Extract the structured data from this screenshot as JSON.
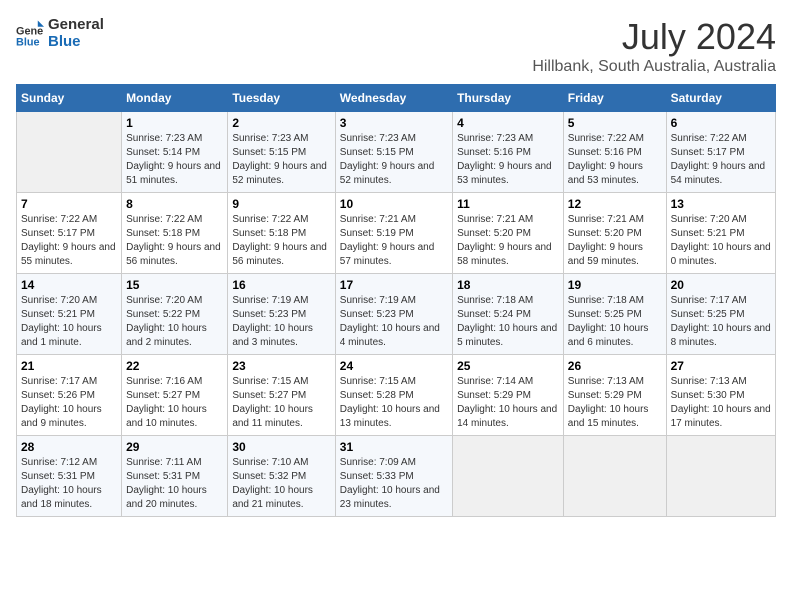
{
  "logo": {
    "text_general": "General",
    "text_blue": "Blue"
  },
  "title": "July 2024",
  "subtitle": "Hillbank, South Australia, Australia",
  "days_of_week": [
    "Sunday",
    "Monday",
    "Tuesday",
    "Wednesday",
    "Thursday",
    "Friday",
    "Saturday"
  ],
  "weeks": [
    [
      {
        "day": "",
        "sunrise": "",
        "sunset": "",
        "daylight": ""
      },
      {
        "day": "1",
        "sunrise": "Sunrise: 7:23 AM",
        "sunset": "Sunset: 5:14 PM",
        "daylight": "Daylight: 9 hours and 51 minutes."
      },
      {
        "day": "2",
        "sunrise": "Sunrise: 7:23 AM",
        "sunset": "Sunset: 5:15 PM",
        "daylight": "Daylight: 9 hours and 52 minutes."
      },
      {
        "day": "3",
        "sunrise": "Sunrise: 7:23 AM",
        "sunset": "Sunset: 5:15 PM",
        "daylight": "Daylight: 9 hours and 52 minutes."
      },
      {
        "day": "4",
        "sunrise": "Sunrise: 7:23 AM",
        "sunset": "Sunset: 5:16 PM",
        "daylight": "Daylight: 9 hours and 53 minutes."
      },
      {
        "day": "5",
        "sunrise": "Sunrise: 7:22 AM",
        "sunset": "Sunset: 5:16 PM",
        "daylight": "Daylight: 9 hours and 53 minutes."
      },
      {
        "day": "6",
        "sunrise": "Sunrise: 7:22 AM",
        "sunset": "Sunset: 5:17 PM",
        "daylight": "Daylight: 9 hours and 54 minutes."
      }
    ],
    [
      {
        "day": "7",
        "sunrise": "Sunrise: 7:22 AM",
        "sunset": "Sunset: 5:17 PM",
        "daylight": "Daylight: 9 hours and 55 minutes."
      },
      {
        "day": "8",
        "sunrise": "Sunrise: 7:22 AM",
        "sunset": "Sunset: 5:18 PM",
        "daylight": "Daylight: 9 hours and 56 minutes."
      },
      {
        "day": "9",
        "sunrise": "Sunrise: 7:22 AM",
        "sunset": "Sunset: 5:18 PM",
        "daylight": "Daylight: 9 hours and 56 minutes."
      },
      {
        "day": "10",
        "sunrise": "Sunrise: 7:21 AM",
        "sunset": "Sunset: 5:19 PM",
        "daylight": "Daylight: 9 hours and 57 minutes."
      },
      {
        "day": "11",
        "sunrise": "Sunrise: 7:21 AM",
        "sunset": "Sunset: 5:20 PM",
        "daylight": "Daylight: 9 hours and 58 minutes."
      },
      {
        "day": "12",
        "sunrise": "Sunrise: 7:21 AM",
        "sunset": "Sunset: 5:20 PM",
        "daylight": "Daylight: 9 hours and 59 minutes."
      },
      {
        "day": "13",
        "sunrise": "Sunrise: 7:20 AM",
        "sunset": "Sunset: 5:21 PM",
        "daylight": "Daylight: 10 hours and 0 minutes."
      }
    ],
    [
      {
        "day": "14",
        "sunrise": "Sunrise: 7:20 AM",
        "sunset": "Sunset: 5:21 PM",
        "daylight": "Daylight: 10 hours and 1 minute."
      },
      {
        "day": "15",
        "sunrise": "Sunrise: 7:20 AM",
        "sunset": "Sunset: 5:22 PM",
        "daylight": "Daylight: 10 hours and 2 minutes."
      },
      {
        "day": "16",
        "sunrise": "Sunrise: 7:19 AM",
        "sunset": "Sunset: 5:23 PM",
        "daylight": "Daylight: 10 hours and 3 minutes."
      },
      {
        "day": "17",
        "sunrise": "Sunrise: 7:19 AM",
        "sunset": "Sunset: 5:23 PM",
        "daylight": "Daylight: 10 hours and 4 minutes."
      },
      {
        "day": "18",
        "sunrise": "Sunrise: 7:18 AM",
        "sunset": "Sunset: 5:24 PM",
        "daylight": "Daylight: 10 hours and 5 minutes."
      },
      {
        "day": "19",
        "sunrise": "Sunrise: 7:18 AM",
        "sunset": "Sunset: 5:25 PM",
        "daylight": "Daylight: 10 hours and 6 minutes."
      },
      {
        "day": "20",
        "sunrise": "Sunrise: 7:17 AM",
        "sunset": "Sunset: 5:25 PM",
        "daylight": "Daylight: 10 hours and 8 minutes."
      }
    ],
    [
      {
        "day": "21",
        "sunrise": "Sunrise: 7:17 AM",
        "sunset": "Sunset: 5:26 PM",
        "daylight": "Daylight: 10 hours and 9 minutes."
      },
      {
        "day": "22",
        "sunrise": "Sunrise: 7:16 AM",
        "sunset": "Sunset: 5:27 PM",
        "daylight": "Daylight: 10 hours and 10 minutes."
      },
      {
        "day": "23",
        "sunrise": "Sunrise: 7:15 AM",
        "sunset": "Sunset: 5:27 PM",
        "daylight": "Daylight: 10 hours and 11 minutes."
      },
      {
        "day": "24",
        "sunrise": "Sunrise: 7:15 AM",
        "sunset": "Sunset: 5:28 PM",
        "daylight": "Daylight: 10 hours and 13 minutes."
      },
      {
        "day": "25",
        "sunrise": "Sunrise: 7:14 AM",
        "sunset": "Sunset: 5:29 PM",
        "daylight": "Daylight: 10 hours and 14 minutes."
      },
      {
        "day": "26",
        "sunrise": "Sunrise: 7:13 AM",
        "sunset": "Sunset: 5:29 PM",
        "daylight": "Daylight: 10 hours and 15 minutes."
      },
      {
        "day": "27",
        "sunrise": "Sunrise: 7:13 AM",
        "sunset": "Sunset: 5:30 PM",
        "daylight": "Daylight: 10 hours and 17 minutes."
      }
    ],
    [
      {
        "day": "28",
        "sunrise": "Sunrise: 7:12 AM",
        "sunset": "Sunset: 5:31 PM",
        "daylight": "Daylight: 10 hours and 18 minutes."
      },
      {
        "day": "29",
        "sunrise": "Sunrise: 7:11 AM",
        "sunset": "Sunset: 5:31 PM",
        "daylight": "Daylight: 10 hours and 20 minutes."
      },
      {
        "day": "30",
        "sunrise": "Sunrise: 7:10 AM",
        "sunset": "Sunset: 5:32 PM",
        "daylight": "Daylight: 10 hours and 21 minutes."
      },
      {
        "day": "31",
        "sunrise": "Sunrise: 7:09 AM",
        "sunset": "Sunset: 5:33 PM",
        "daylight": "Daylight: 10 hours and 23 minutes."
      },
      {
        "day": "",
        "sunrise": "",
        "sunset": "",
        "daylight": ""
      },
      {
        "day": "",
        "sunrise": "",
        "sunset": "",
        "daylight": ""
      },
      {
        "day": "",
        "sunrise": "",
        "sunset": "",
        "daylight": ""
      }
    ]
  ]
}
